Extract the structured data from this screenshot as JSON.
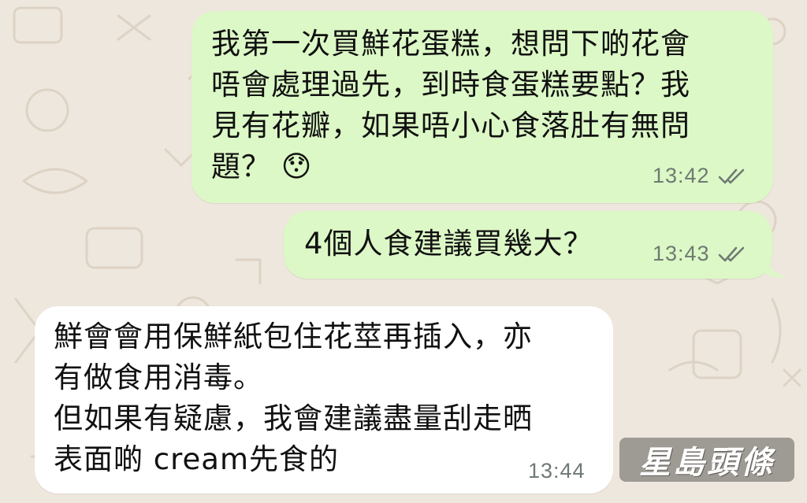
{
  "messages": [
    {
      "direction": "outgoing",
      "text": "我第一次買鮮花蛋糕，想問下啲花會\n唔會處理過先，到時食蛋糕要點？我\n見有花瓣，如果唔小心食落肚有無問\n題？ 😯",
      "time": "13:42",
      "status": "read-double-tick"
    },
    {
      "direction": "outgoing",
      "text": "4個人食建議買幾大？",
      "time": "13:43",
      "status": "read-double-tick"
    },
    {
      "direction": "incoming",
      "text": "鮮會會用保鮮紙包住花莖再插入，亦\n有做食用消毒。\n但如果有疑慮，我會建議盡量刮走晒\n表面啲 cream先食的",
      "time": "13:44"
    }
  ],
  "watermark": "星島頭條",
  "colors": {
    "background": "#eee7dd",
    "outgoing_bubble": "#dcf8c6",
    "incoming_bubble": "#ffffff",
    "time_text": "#6f7a73",
    "tick": "#6f7a73"
  }
}
